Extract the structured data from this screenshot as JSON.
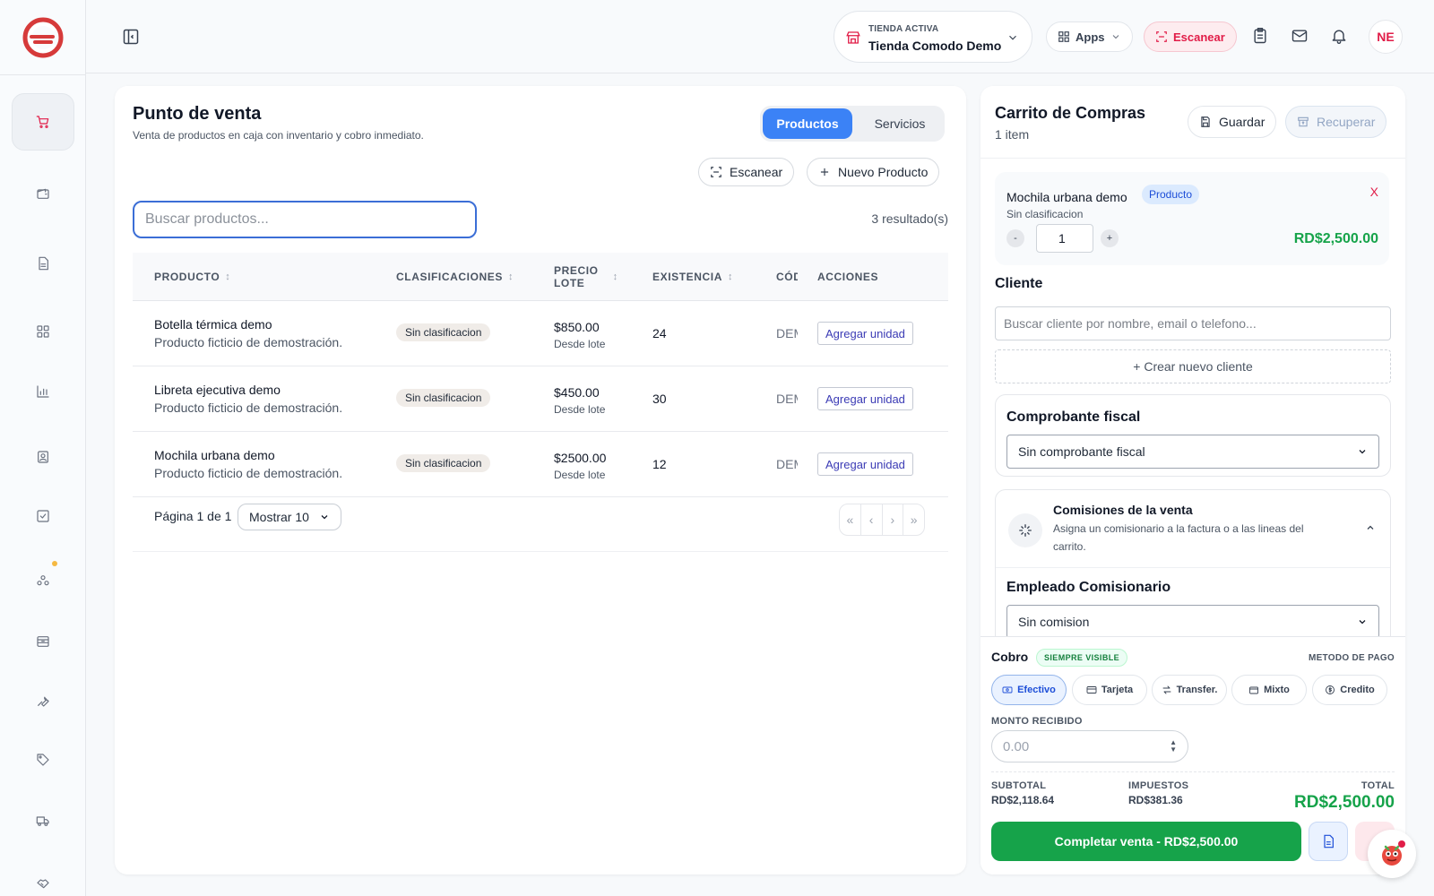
{
  "header": {
    "store_label": "TIENDA ACTIVA",
    "store_name": "Tienda Comodo Demo",
    "apps_label": "Apps",
    "scan_label": "Escanear",
    "avatar_initials": "NE"
  },
  "sidebar": {
    "items": [
      "cart-icon",
      "wallet-icon",
      "document-icon",
      "grid-icon",
      "chart-icon",
      "contact-icon",
      "checkbox-icon",
      "group-icon",
      "archive-icon",
      "wrench-icon",
      "tag-icon",
      "truck-icon",
      "handshake-icon"
    ],
    "active": "cart-icon"
  },
  "main": {
    "title": "Punto de venta",
    "subtitle": "Venta de productos en caja con inventario y cobro inmediato.",
    "tabs": [
      {
        "label": "Productos",
        "active": true
      },
      {
        "label": "Servicios",
        "active": false
      }
    ],
    "scan_button": "Escanear",
    "new_product_button": "Nuevo Producto",
    "search_placeholder": "Buscar productos...",
    "results": "3 resultado(s)",
    "columns": {
      "product": "PRODUCTO",
      "classifications": "CLASIFICACIONES",
      "price_lot_1": "PRECIO",
      "price_lot_2": "LOTE",
      "stock": "EXISTENCIA",
      "code": "CÓDIGO",
      "actions": "ACCIONES"
    },
    "rows": [
      {
        "name": "Botella térmica demo",
        "desc": "Producto ficticio de demostración.",
        "class": "Sin clasificacion",
        "price": "$850.00",
        "price_note": "Desde lote",
        "stock": "24",
        "code": "DEMO",
        "action": "Agregar unidad"
      },
      {
        "name": "Libreta ejecutiva demo",
        "desc": "Producto ficticio de demostración.",
        "class": "Sin clasificacion",
        "price": "$450.00",
        "price_note": "Desde lote",
        "stock": "30",
        "code": "DEMO",
        "action": "Agregar unidad"
      },
      {
        "name": "Mochila urbana demo",
        "desc": "Producto ficticio de demostración.",
        "class": "Sin clasificacion",
        "price": "$2500.00",
        "price_note": "Desde lote",
        "stock": "12",
        "code": "DEMO",
        "action": "Agregar unidad"
      }
    ],
    "pager": "Página 1 de 1",
    "page_size": "Mostrar 10",
    "nav": [
      "«",
      "‹",
      "›",
      "»"
    ]
  },
  "cart": {
    "title": "Carrito de Compras",
    "count": "1 item",
    "save": "Guardar",
    "recover": "Recuperar",
    "item": {
      "name": "Mochila urbana demo",
      "type": "Producto",
      "remove": "X",
      "classification": "Sin clasificacion",
      "minus": "-",
      "qty": "1",
      "plus": "+",
      "price": "RD$2,500.00"
    },
    "client_label": "Cliente",
    "client_placeholder": "Buscar cliente por nombre, email o telefono...",
    "new_client": "+ Crear nuevo cliente",
    "fiscal_label": "Comprobante fiscal",
    "fiscal_value": "Sin comprobante fiscal",
    "commission_title": "Comisiones de la venta",
    "commission_desc_1": "Asigna un comisionario a la factura o a las lineas del",
    "commission_desc_2": "carrito.",
    "employee_label": "Empleado Comisionario",
    "employee_value": "Sin comision"
  },
  "payment": {
    "title": "Cobro",
    "badge": "SIEMPRE VISIBLE",
    "method_label": "METODO DE PAGO",
    "methods": [
      {
        "label": "Efectivo",
        "active": true
      },
      {
        "label": "Tarjeta",
        "active": false
      },
      {
        "label": "Transfer.",
        "active": false
      },
      {
        "label": "Mixto",
        "active": false
      },
      {
        "label": "Credito",
        "active": false
      }
    ],
    "amount_label": "MONTO RECIBIDO",
    "amount_placeholder": "0.00",
    "subtotal_label": "SUBTOTAL",
    "subtotal": "RD$2,118.64",
    "tax_label": "IMPUESTOS",
    "tax": "RD$381.36",
    "total_label": "TOTAL",
    "total": "RD$2,500.00",
    "complete_button": "Completar venta - RD$2,500.00"
  },
  "colors": {
    "brand": "#e11d48",
    "primary": "#3b82f6",
    "success": "#16a34a"
  }
}
